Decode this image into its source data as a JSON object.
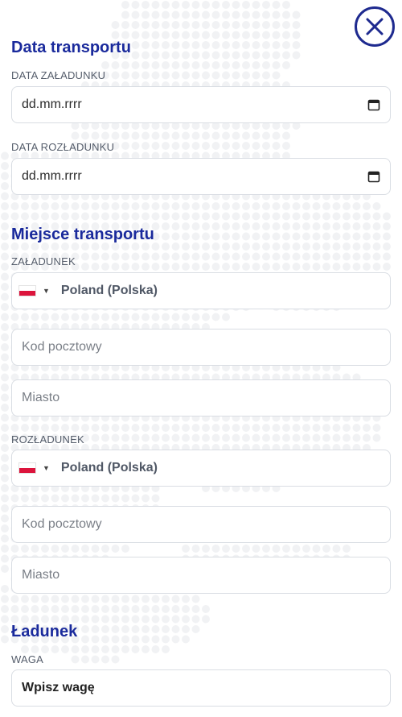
{
  "close_icon": "close-icon",
  "sections": {
    "transport_date": {
      "title": "Data transportu",
      "loading_date": {
        "label": "DATA ZAŁADUNKU",
        "value": "dd.mm.rrrr"
      },
      "unloading_date": {
        "label": "DATA ROZŁADUNKU",
        "value": "dd.mm.rrrr"
      }
    },
    "transport_place": {
      "title": "Miejsce transportu",
      "loading": {
        "label": "ZAŁADUNEK",
        "country": "Poland (Polska)",
        "postal_placeholder": "Kod pocztowy",
        "city_placeholder": "Miasto"
      },
      "unloading": {
        "label": "ROZŁADUNEK",
        "country": "Poland (Polska)",
        "postal_placeholder": "Kod pocztowy",
        "city_placeholder": "Miasto"
      }
    },
    "cargo": {
      "title": "Ładunek",
      "weight": {
        "label": "WAGA",
        "placeholder": "Wpisz wagę"
      }
    }
  },
  "colors": {
    "accent": "#1a2a9c",
    "flag_red": "#dc143c"
  }
}
